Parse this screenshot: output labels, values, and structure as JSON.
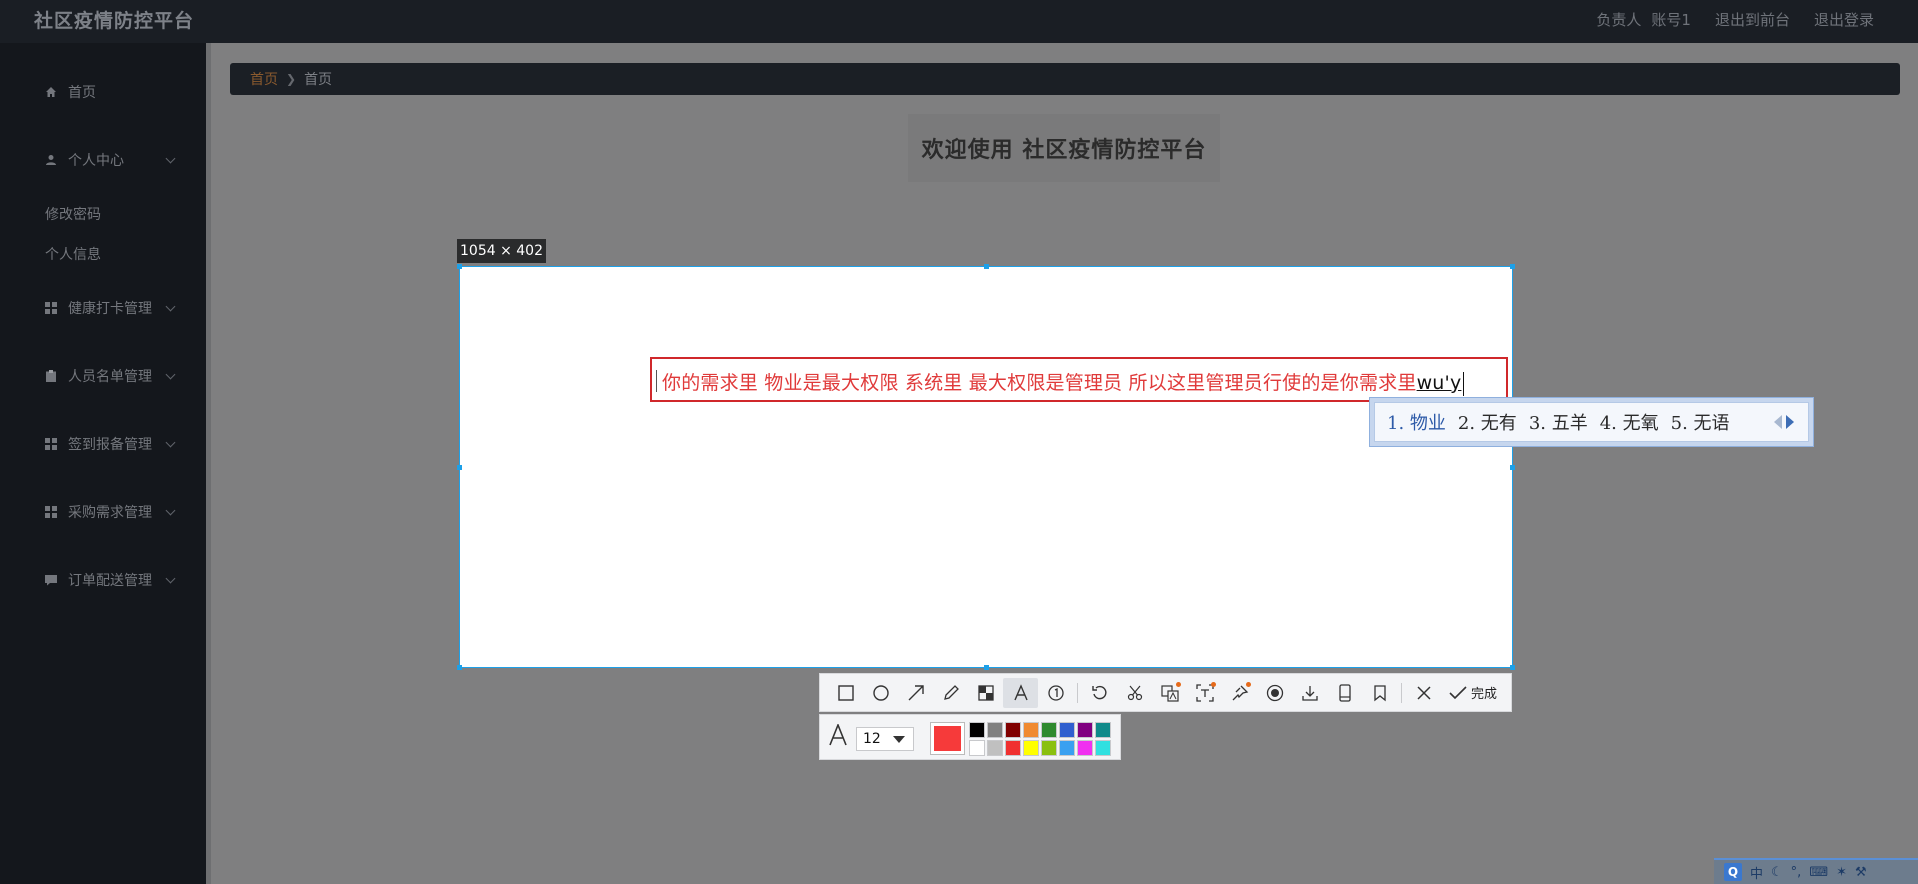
{
  "header": {
    "brand": "社区疫情防控平台",
    "user_role": "负责人",
    "user_account": "账号1",
    "link_front": "退出到前台",
    "link_logout": "退出登录"
  },
  "sidebar": {
    "items": [
      {
        "label": "首页",
        "icon": "home-icon"
      },
      {
        "label": "个人中心",
        "icon": "user-icon"
      },
      {
        "label": "健康打卡管理",
        "icon": "grid-icon"
      },
      {
        "label": "人员名单管理",
        "icon": "clipboard-icon"
      },
      {
        "label": "签到报备管理",
        "icon": "grid-icon"
      },
      {
        "label": "采购需求管理",
        "icon": "grid-icon"
      },
      {
        "label": "订单配送管理",
        "icon": "chat-icon"
      }
    ],
    "subitems": [
      "修改密码",
      "个人信息"
    ]
  },
  "breadcrumb": {
    "home": "首页",
    "current": "首页"
  },
  "welcome": "欢迎使用 社区疫情防控平台",
  "capture": {
    "size_label": "1054 × 402",
    "typed_text": "你的需求里 物业是最大权限  系统里 最大权限是管理员 所以这里管理员行使的是你需求里",
    "pinyin": "wu'y"
  },
  "ime": {
    "candidates": [
      "1. 物业",
      "2. 无有",
      "3. 五羊",
      "4. 无氧",
      "5. 无语"
    ]
  },
  "toolbar": {
    "done_label": "完成",
    "font_size": "12",
    "current_color": "#f63a3a",
    "palette": [
      "#000000",
      "#808080",
      "#800000",
      "#f08a30",
      "#2f8a2f",
      "#2f5fcf",
      "#800080",
      "#108a8a",
      "#ffffff",
      "#c0c0c0",
      "#f03030",
      "#ffff00",
      "#8ac010",
      "#3aa0f0",
      "#f030f0",
      "#30e0e0"
    ]
  },
  "tray": {
    "ime_mode": "中"
  }
}
